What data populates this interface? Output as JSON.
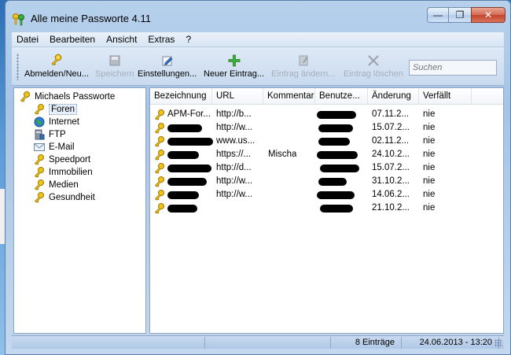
{
  "window": {
    "title": "Alle meine Passworte 4.11"
  },
  "window_buttons": {
    "minimize": "—",
    "restore": "❐",
    "close": "✕"
  },
  "menu": [
    "Datei",
    "Bearbeiten",
    "Ansicht",
    "Extras",
    "?"
  ],
  "toolbar": {
    "logout_label": "Abmelden/Neu...",
    "save_label": "Speichern",
    "settings_label": "Einstellungen...",
    "new_entry_label": "Neuer Eintrag...",
    "edit_entry_label": "Eintrag ändern...",
    "delete_entry_label": "Eintrag löschen",
    "search_placeholder": "Suchen"
  },
  "tree": {
    "root": "Michaels Passworte",
    "items": [
      {
        "label": "Foren",
        "icon": "key-icon"
      },
      {
        "label": "Internet",
        "icon": "globe-icon"
      },
      {
        "label": "FTP",
        "icon": "server-icon"
      },
      {
        "label": "E-Mail",
        "icon": "mail-icon"
      },
      {
        "label": "Speedport",
        "icon": "key-icon"
      },
      {
        "label": "Immobilien",
        "icon": "key-icon"
      },
      {
        "label": "Medien",
        "icon": "key-icon"
      },
      {
        "label": "Gesundheit",
        "icon": "key-icon"
      }
    ]
  },
  "list": {
    "columns": [
      "Bezeichnung",
      "URL",
      "Kommentar",
      "Benutze...",
      "Änderung",
      "Verfällt"
    ],
    "rows": [
      {
        "name": "APM-For...",
        "url": "http://b...",
        "comment": "",
        "changed": "07.11.2...",
        "expires": "nie"
      },
      {
        "name": "",
        "url": "http://w...",
        "comment": "",
        "changed": "15.07.2...",
        "expires": "nie"
      },
      {
        "name": "",
        "url": "www.us...",
        "comment": "",
        "changed": "02.11.2...",
        "expires": "nie"
      },
      {
        "name": "",
        "url": "https://...",
        "comment": "Mischa",
        "changed": "24.10.2...",
        "expires": "nie"
      },
      {
        "name": "",
        "url": "http://d...",
        "comment": "",
        "changed": "15.07.2...",
        "expires": "nie"
      },
      {
        "name": "",
        "url": "http://w...",
        "comment": "",
        "changed": "31.10.2...",
        "expires": "nie"
      },
      {
        "name": "",
        "url": "http://w...",
        "comment": "",
        "changed": "14.06.2...",
        "expires": "nie"
      },
      {
        "name": "",
        "url": "",
        "comment": "",
        "changed": "21.10.2...",
        "expires": "nie"
      }
    ]
  },
  "status": {
    "count": "8 Einträge",
    "datetime": "24.06.2013 - 13:20"
  },
  "colors": {
    "accent": "#1f8a1f",
    "selection": "#e5eef9"
  }
}
